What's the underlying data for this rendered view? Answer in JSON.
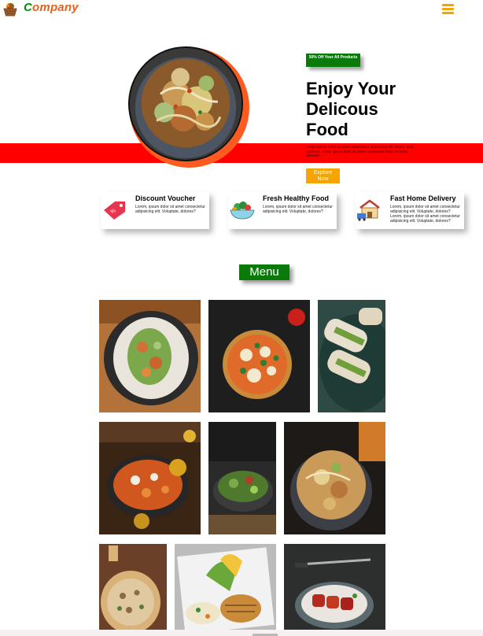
{
  "header": {
    "brand_first": "C",
    "brand_rest": "ompany",
    "logo_icon": "food-basket-icon",
    "menu_icon": "hamburger-menu-icon",
    "accent": "#f0a500"
  },
  "hero": {
    "badge": "50% Off Your All Products",
    "title_line1": "Enjoy Your",
    "title_line2": "Delicous",
    "title_line3": "Food",
    "description": "Lorem ipsum dolor sit amet consectetur adipisicing elit. Nemo, quia ducimus. Lorem ipsum dolor sit amet consectetur illum ut omnis dolores?",
    "button": "Explore Now",
    "band_color": "#ff0000",
    "badge_color": "#0a7a0a",
    "button_color": "#f5a400"
  },
  "features": [
    {
      "title": "Discount Voucher",
      "icon": "voucher-tag-icon",
      "text": "Lorem, ipsum dolor sit amet consectetur adipisicing elit. Voluptate, dolores?"
    },
    {
      "title": "Fresh Healthy Food",
      "icon": "salad-bowl-icon",
      "text": "Lorem, ipsum dolor sit amet consectetur adipisicing elit. Voluptate, dolores?"
    },
    {
      "title": "Fast Home Delivery",
      "icon": "delivery-house-icon",
      "text": "Lorem, ipsum dolor sit amet consectetur adipisicing elit. Voluptate, dolores? Lorem, ipsum dolor sit amet consectetur adipisicing elit. Voluptate, dolores?"
    }
  ],
  "menu": {
    "title": "Menu",
    "items": [
      {
        "image": "noodle-salad-plate"
      },
      {
        "image": "pizza"
      },
      {
        "image": "sandwich-wraps"
      },
      {
        "image": "curry-pan"
      },
      {
        "image": "salad-bowl"
      },
      {
        "image": "noodle-bowl"
      },
      {
        "image": "pizza-board"
      },
      {
        "image": "grilled-chicken-plate"
      },
      {
        "image": "skewers-plate"
      }
    ]
  }
}
